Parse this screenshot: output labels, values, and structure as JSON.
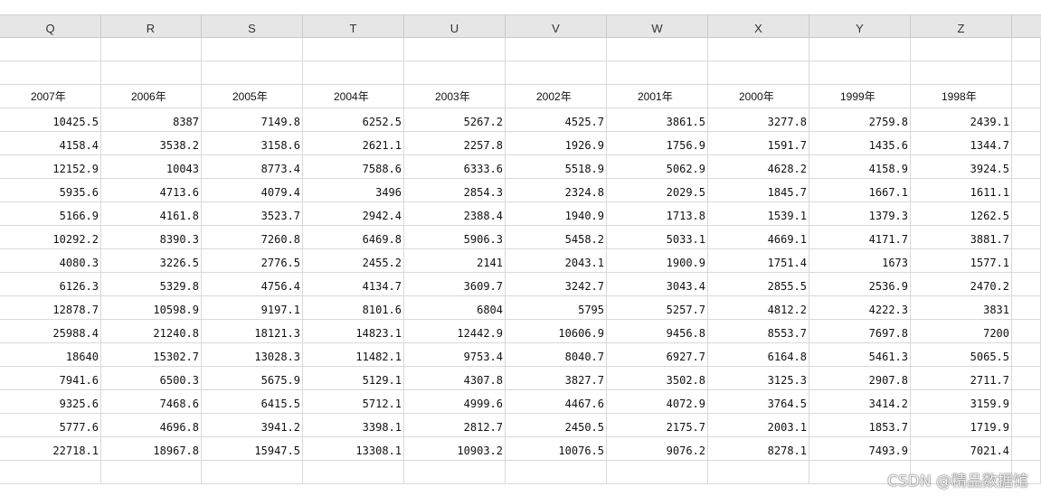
{
  "columns": [
    "Q",
    "R",
    "S",
    "T",
    "U",
    "V",
    "W",
    "X",
    "Y",
    "Z"
  ],
  "years": [
    "2007年",
    "2006年",
    "2005年",
    "2004年",
    "2003年",
    "2002年",
    "2001年",
    "2000年",
    "1999年",
    "1998年"
  ],
  "rows": [
    [
      "10425.5",
      "8387",
      "7149.8",
      "6252.5",
      "5267.2",
      "4525.7",
      "3861.5",
      "3277.8",
      "2759.8",
      "2439.1"
    ],
    [
      "4158.4",
      "3538.2",
      "3158.6",
      "2621.1",
      "2257.8",
      "1926.9",
      "1756.9",
      "1591.7",
      "1435.6",
      "1344.7"
    ],
    [
      "12152.9",
      "10043",
      "8773.4",
      "7588.6",
      "6333.6",
      "5518.9",
      "5062.9",
      "4628.2",
      "4158.9",
      "3924.5"
    ],
    [
      "5935.6",
      "4713.6",
      "4079.4",
      "3496",
      "2854.3",
      "2324.8",
      "2029.5",
      "1845.7",
      "1667.1",
      "1611.1"
    ],
    [
      "5166.9",
      "4161.8",
      "3523.7",
      "2942.4",
      "2388.4",
      "1940.9",
      "1713.8",
      "1539.1",
      "1379.3",
      "1262.5"
    ],
    [
      "10292.2",
      "8390.3",
      "7260.8",
      "6469.8",
      "5906.3",
      "5458.2",
      "5033.1",
      "4669.1",
      "4171.7",
      "3881.7"
    ],
    [
      "4080.3",
      "3226.5",
      "2776.5",
      "2455.2",
      "2141",
      "2043.1",
      "1900.9",
      "1751.4",
      "1673",
      "1577.1"
    ],
    [
      "6126.3",
      "5329.8",
      "4756.4",
      "4134.7",
      "3609.7",
      "3242.7",
      "3043.4",
      "2855.5",
      "2536.9",
      "2470.2"
    ],
    [
      "12878.7",
      "10598.9",
      "9197.1",
      "8101.6",
      "6804",
      "5795",
      "5257.7",
      "4812.2",
      "4222.3",
      "3831"
    ],
    [
      "25988.4",
      "21240.8",
      "18121.3",
      "14823.1",
      "12442.9",
      "10606.9",
      "9456.8",
      "8553.7",
      "7697.8",
      "7200"
    ],
    [
      "18640",
      "15302.7",
      "13028.3",
      "11482.1",
      "9753.4",
      "8040.7",
      "6927.7",
      "6164.8",
      "5461.3",
      "5065.5"
    ],
    [
      "7941.6",
      "6500.3",
      "5675.9",
      "5129.1",
      "4307.8",
      "3827.7",
      "3502.8",
      "3125.3",
      "2907.8",
      "2711.7"
    ],
    [
      "9325.6",
      "7468.6",
      "6415.5",
      "5712.1",
      "4999.6",
      "4467.6",
      "4072.9",
      "3764.5",
      "3414.2",
      "3159.9"
    ],
    [
      "5777.6",
      "4696.8",
      "3941.2",
      "3398.1",
      "2812.7",
      "2450.5",
      "2175.7",
      "2003.1",
      "1853.7",
      "1719.9"
    ],
    [
      "22718.1",
      "18967.8",
      "15947.5",
      "13308.1",
      "10903.2",
      "10076.5",
      "9076.2",
      "8278.1",
      "7493.9",
      "7021.4"
    ]
  ],
  "watermark": "CSDN @精品数据馆"
}
